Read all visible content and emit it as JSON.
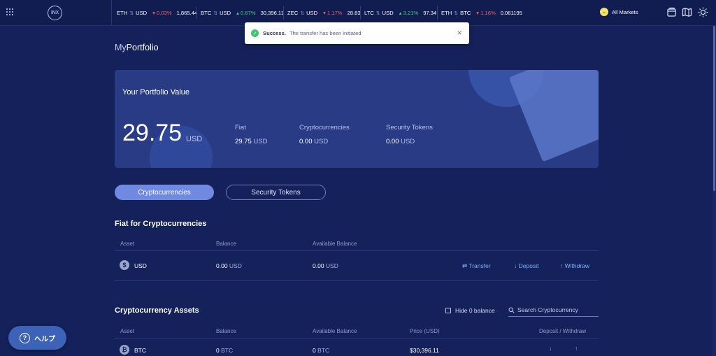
{
  "header": {
    "logo_text": "INX",
    "tickers": [
      {
        "base": "ETH",
        "quote": "USD",
        "change": "0.03%",
        "direction": "down",
        "price": "1,865.44"
      },
      {
        "base": "BTC",
        "quote": "USD",
        "change": "0.67%",
        "direction": "up",
        "price": "30,396.11"
      },
      {
        "base": "ZEC",
        "quote": "USD",
        "change": "1.17%",
        "direction": "down",
        "price": "28.83"
      },
      {
        "base": "LTC",
        "quote": "USD",
        "change": "3.21%",
        "direction": "up",
        "price": "97.34"
      },
      {
        "base": "ETH",
        "quote": "BTC",
        "change": "1.16%",
        "direction": "down",
        "price": "0.061195"
      }
    ],
    "markets_label": "All Markets",
    "icons": [
      "wallet-icon",
      "map-icon",
      "sun-icon"
    ]
  },
  "toast": {
    "title": "Success.",
    "message": "The transfer has been initiated"
  },
  "page": {
    "title_prefix": "My",
    "title_main": "Portfolio"
  },
  "portfolio": {
    "label": "Your Portfolio Value",
    "value": "29.75",
    "unit": "USD",
    "stats": [
      {
        "label": "Fiat",
        "value": "29.75",
        "unit": "USD"
      },
      {
        "label": "Cryptocurrencies",
        "value": "0.00",
        "unit": "USD"
      },
      {
        "label": "Security Tokens",
        "value": "0.00",
        "unit": "USD"
      }
    ]
  },
  "tabs": [
    "Cryptocurrencies",
    "Security Tokens"
  ],
  "fiat_section": {
    "title": "Fiat for Cryptocurrencies",
    "columns": [
      "Asset",
      "Balance",
      "Available Balance"
    ],
    "row": {
      "asset": "USD",
      "balance": "0.00",
      "balance_unit": "USD",
      "available": "0.00",
      "available_unit": "USD",
      "actions": [
        "Transfer",
        "Deposit",
        "Withdraw"
      ]
    }
  },
  "crypto_section": {
    "title": "Cryptocurrency Assets",
    "hide_zero_label": "Hide 0 balance",
    "search_placeholder": "Search Cryptocurrency",
    "columns": [
      "Asset",
      "Balance",
      "Available Balance",
      "Price (USD)",
      "Deposit / Withdraw"
    ],
    "row": {
      "asset": "BTC",
      "balance": "0",
      "balance_unit": "BTC",
      "available": "0",
      "available_unit": "BTC",
      "price": "$30,396.11"
    }
  },
  "help_label": "ヘルプ"
}
